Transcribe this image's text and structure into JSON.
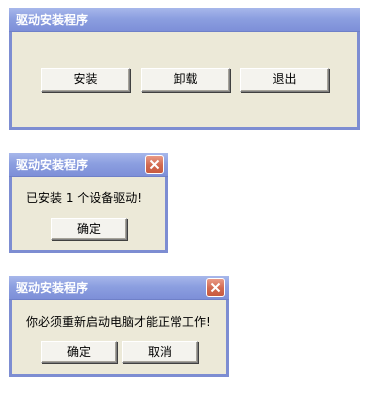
{
  "dialog_main": {
    "title": "驱动安装程序",
    "buttons": {
      "install": "安装",
      "uninstall": "卸载",
      "exit": "退出"
    }
  },
  "dialog_installed": {
    "title": "驱动安装程序",
    "message": "已安装 1 个设备驱动!",
    "ok_label": "确定"
  },
  "dialog_restart": {
    "title": "驱动安装程序",
    "message": "你必须重新启动电脑才能正常工作!",
    "ok_label": "确定",
    "cancel_label": "取消"
  },
  "icons": {
    "close": "close-icon"
  },
  "colors": {
    "titlebar": "#8c9fe0",
    "window_bg": "#ece9d8",
    "close_button": "#d1694f"
  }
}
